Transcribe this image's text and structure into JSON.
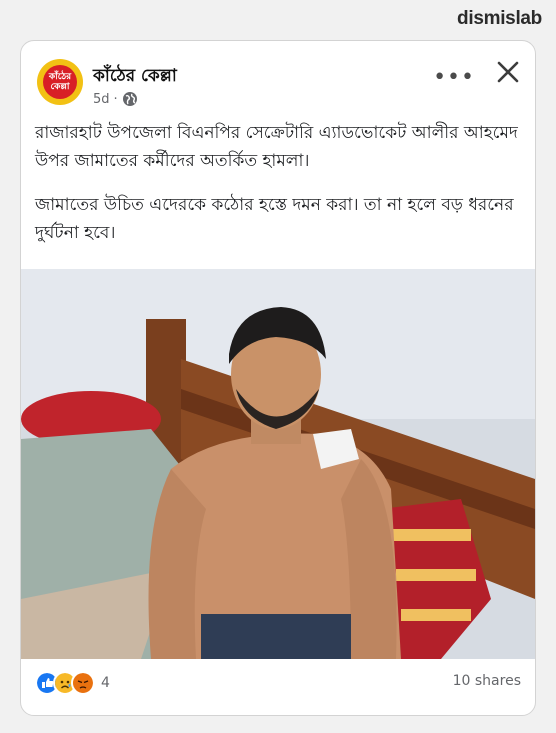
{
  "watermark": "dismislab",
  "post": {
    "page_name": "কাঁঠের কেল্লা",
    "avatar_text": "কাঁঠের কেল্লা",
    "time": "5d",
    "privacy_icon": "globe-icon",
    "more_icon": "more-dots-icon",
    "close_icon": "close-icon",
    "paragraphs": [
      "রাজারহাট উপজেলা বিএনপির সেক্রেটারি এ্যাডভোকেট আলীর আহমেদ উপর জামাতের কর্মীদের অতর্কিত হামলা।",
      "জামাতের উচিত এদেরকে কঠোর হস্তে দমন করা। তা না হলে বড় ধরনের দুর্ঘটনা হবে।"
    ],
    "photo_description": "shirtless man with bandage on shoulder sitting on bed",
    "reaction_count": "4",
    "shares": "10 shares"
  },
  "colors": {
    "brand_yellow": "#f2c114",
    "brand_red": "#d81f26",
    "like_blue": "#1877f2",
    "sad_yellow": "#f7b928",
    "angry_red": "#e9710f"
  }
}
